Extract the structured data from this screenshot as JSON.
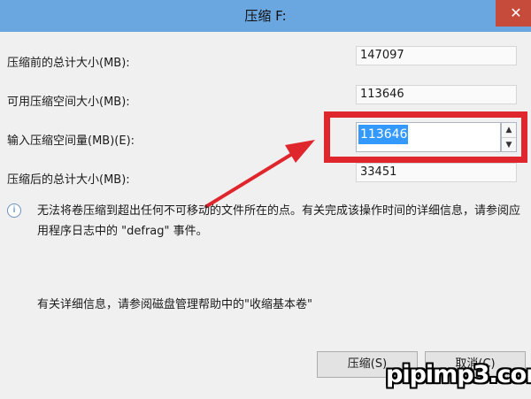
{
  "window": {
    "title": "压缩 F:",
    "close_symbol": "✕"
  },
  "fields": {
    "total_before": {
      "label": "压缩前的总计大小(MB):",
      "value": "147097"
    },
    "available": {
      "label": "可用压缩空间大小(MB):",
      "value": "113646"
    },
    "shrink_amount": {
      "label": "输入压缩空间量(MB)(E):",
      "value": "113646",
      "spin_up": "▲",
      "spin_down": "▼"
    },
    "total_after": {
      "label": "压缩后的总计大小(MB):",
      "value": "33451"
    }
  },
  "info_icon": "i",
  "message": "无法将卷压缩到超出任何不可移动的文件所在的点。有关完成该操作时间的详细信息，请参阅应用程序日志中的 \"defrag\" 事件。",
  "detail_link_text": "有关详细信息，请参阅磁盘管理帮助中的\"收缩基本卷\"",
  "buttons": {
    "shrink": "压缩(S)",
    "cancel": "取消(C)"
  },
  "watermark": "pipimp3.com",
  "colors": {
    "titlebar": "#6aa7e1",
    "highlight": "#e0262d",
    "selection": "#3399ff",
    "close": "#c74b3b"
  }
}
